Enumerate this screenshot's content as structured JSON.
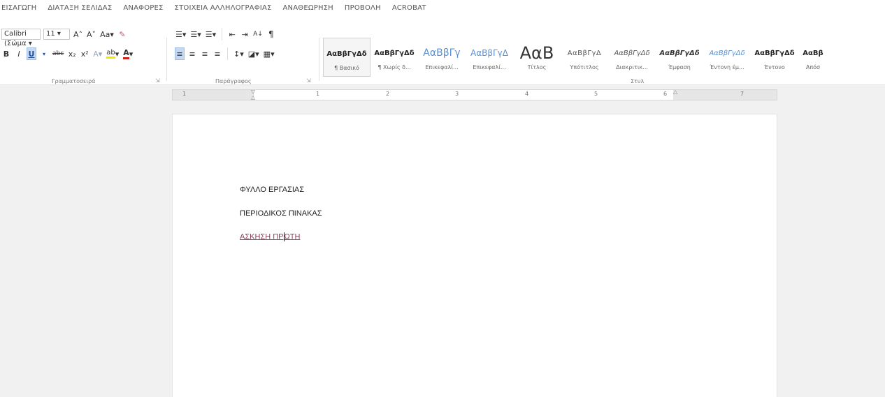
{
  "menu": {
    "tabs": [
      "ΕΙΣΑΓΩΓΗ",
      "ΔΙΑΤΑΞΗ ΣΕΛΙΔΑΣ",
      "ΑΝΑΦΟΡΕΣ",
      "ΣΤΟΙΧΕΙΑ ΑΛΛΗΛΟΓΡΑΦΙΑΣ",
      "ΑΝΑΘΕΩΡΗΣΗ",
      "ΠΡΟΒΟΛΗ",
      "ACROBAT"
    ]
  },
  "font": {
    "name": "Calibri (Σώμα",
    "size": "11",
    "group_label": "Γραμματοσειρά",
    "buttons": {
      "grow": "A˄",
      "shrink": "A˅",
      "case": "Aa",
      "bold": "B",
      "italic": "I",
      "underline": "U",
      "strike": "abc",
      "subscript": "x₂",
      "superscript": "x²",
      "text_effects": "A",
      "highlight": "ab",
      "font_color": "A"
    }
  },
  "paragraph": {
    "group_label": "Παράγραφος",
    "pilcrow": "¶",
    "sort": "A↓"
  },
  "styles": {
    "group_label": "Στυλ",
    "items": [
      {
        "sample": "ΑαΒβΓγΔδ",
        "name": "¶ Βασικό"
      },
      {
        "sample": "ΑαΒβΓγΔδ",
        "name": "¶ Χωρίς δ..."
      },
      {
        "sample": "ΑαΒβΓγ",
        "name": "Επικεφαλί..."
      },
      {
        "sample": "ΑαΒβΓγΔ",
        "name": "Επικεφαλί..."
      },
      {
        "sample": "ΑαΒ",
        "name": "Τίτλος"
      },
      {
        "sample": "ΑαΒβΓγΔ",
        "name": "Υπότιτλος"
      },
      {
        "sample": "ΑαΒβΓγΔδ",
        "name": "Διακριτικ..."
      },
      {
        "sample": "ΑαΒβΓγΔδ",
        "name": "Έμφαση"
      },
      {
        "sample": "ΑαΒβΓγΔδ",
        "name": "Έντονη έμ..."
      },
      {
        "sample": "ΑαΒβΓγΔδ",
        "name": "Έντονο"
      },
      {
        "sample": "ΑαΒβ",
        "name": "Απόσ"
      }
    ]
  },
  "ruler": {
    "numbers": [
      "1",
      "1",
      "2",
      "3",
      "4",
      "5",
      "6",
      "7"
    ]
  },
  "document": {
    "line1": "ΦΥΛΛΟ ΕΡΓΑΣΙΑΣ",
    "line2": "ΠΕΡΙΟΔΙΚΟΣ ΠΙΝΑΚΑΣ",
    "line3_before_caret": "ΑΣΚΗΣΗ ΠΡ",
    "line3_after_caret": "ΩΤΗ"
  },
  "colors": {
    "link": "#8b3f5a",
    "highlight_yellow": "#f2e600",
    "font_red": "#d0201a",
    "selected_bg": "#c5d8f0"
  }
}
